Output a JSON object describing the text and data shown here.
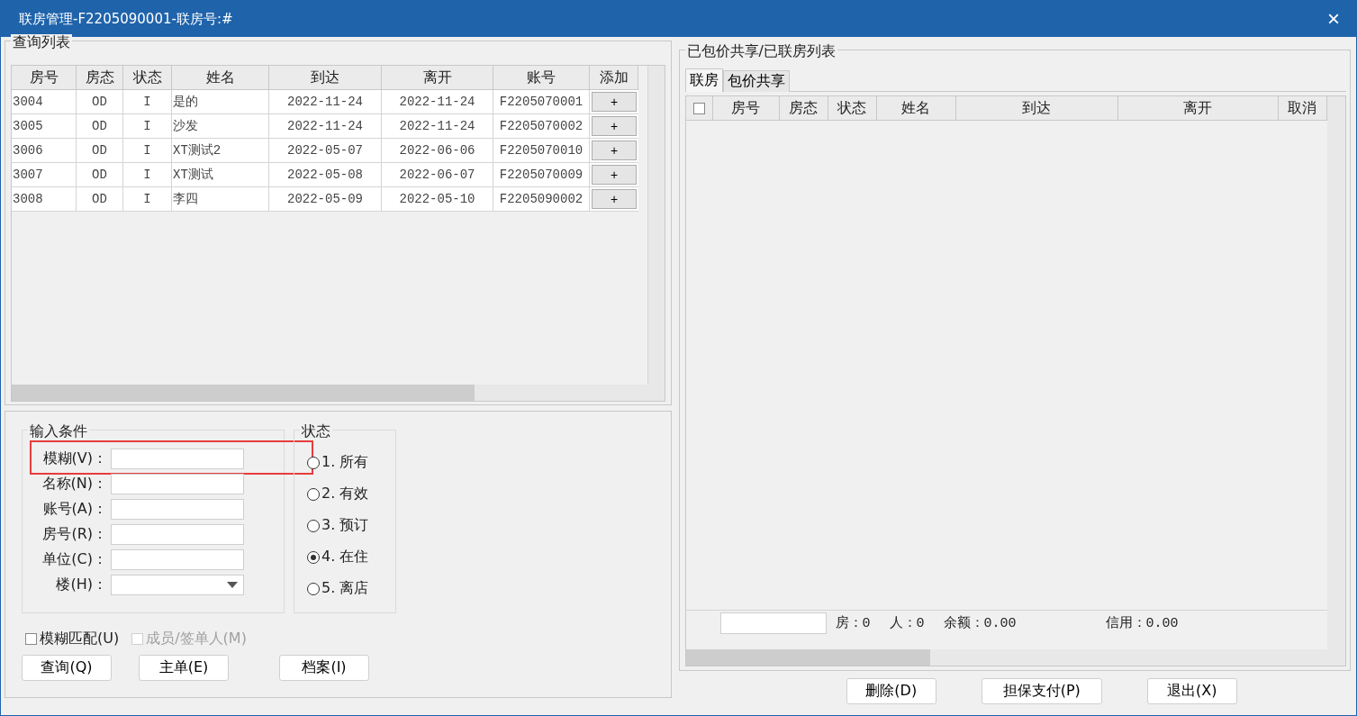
{
  "window": {
    "title": "联房管理-F2205090001-联房号:#",
    "close": "×"
  },
  "query_list": {
    "title": "查询列表",
    "columns": [
      "房号",
      "房态",
      "状态",
      "姓名",
      "到达",
      "离开",
      "账号",
      "添加"
    ],
    "rows": [
      {
        "cells": [
          "3004",
          "OD",
          "I",
          "是的",
          "2022-11-24",
          "2022-11-24",
          "F2205070001"
        ],
        "add": "+"
      },
      {
        "cells": [
          "3005",
          "OD",
          "I",
          "沙发",
          "2022-11-24",
          "2022-11-24",
          "F2205070002"
        ],
        "add": "+"
      },
      {
        "cells": [
          "3006",
          "OD",
          "I",
          "XT测试2",
          "2022-05-07",
          "2022-06-06",
          "F2205070010"
        ],
        "add": "+"
      },
      {
        "cells": [
          "3007",
          "OD",
          "I",
          "XT测试",
          "2022-05-08",
          "2022-06-07",
          "F2205070009"
        ],
        "add": "+"
      },
      {
        "cells": [
          "3008",
          "OD",
          "I",
          "李四",
          "2022-05-09",
          "2022-05-10",
          "F2205090002"
        ],
        "add": "+"
      }
    ]
  },
  "conditions": {
    "title": "输入条件",
    "fields": [
      {
        "label": "模糊(V)：",
        "kind": "text",
        "highlighted": true
      },
      {
        "label": "名称(N)：",
        "kind": "text",
        "highlighted": false
      },
      {
        "label": "账号(A)：",
        "kind": "text",
        "highlighted": false
      },
      {
        "label": "房号(R)：",
        "kind": "text",
        "highlighted": false
      },
      {
        "label": "单位(C)：",
        "kind": "text",
        "highlighted": false
      },
      {
        "label": "楼(H)：",
        "kind": "dropdown",
        "highlighted": false
      }
    ]
  },
  "status": {
    "title": "状态",
    "options": [
      {
        "label": "1. 所有",
        "selected": false
      },
      {
        "label": "2. 有效",
        "selected": false
      },
      {
        "label": "3. 预订",
        "selected": false
      },
      {
        "label": "4. 在住",
        "selected": true
      },
      {
        "label": "5. 离店",
        "selected": false
      }
    ]
  },
  "checkboxes": [
    {
      "label": "模糊匹配(U)",
      "checked": false,
      "disabled": false
    },
    {
      "label": "成员/签单人(M)",
      "checked": false,
      "disabled": true
    }
  ],
  "buttons": [
    "查询(Q)",
    "主单(E)",
    "档案(I)"
  ],
  "linked": {
    "title": "已包价共享/已联房列表",
    "tabs": [
      {
        "label": "联房",
        "selected": true
      },
      {
        "label": "包价共享",
        "selected": false
      }
    ],
    "select_all_checked": false,
    "columns": [
      "房号",
      "房态",
      "状态",
      "姓名",
      "到达",
      "离开",
      "取消"
    ],
    "summary": [
      "房：0",
      "人：0",
      "余额：0.00",
      "信用：0.00"
    ]
  },
  "footer_buttons": [
    "删除(D)",
    "担保支付(P)",
    "退出(X)"
  ]
}
